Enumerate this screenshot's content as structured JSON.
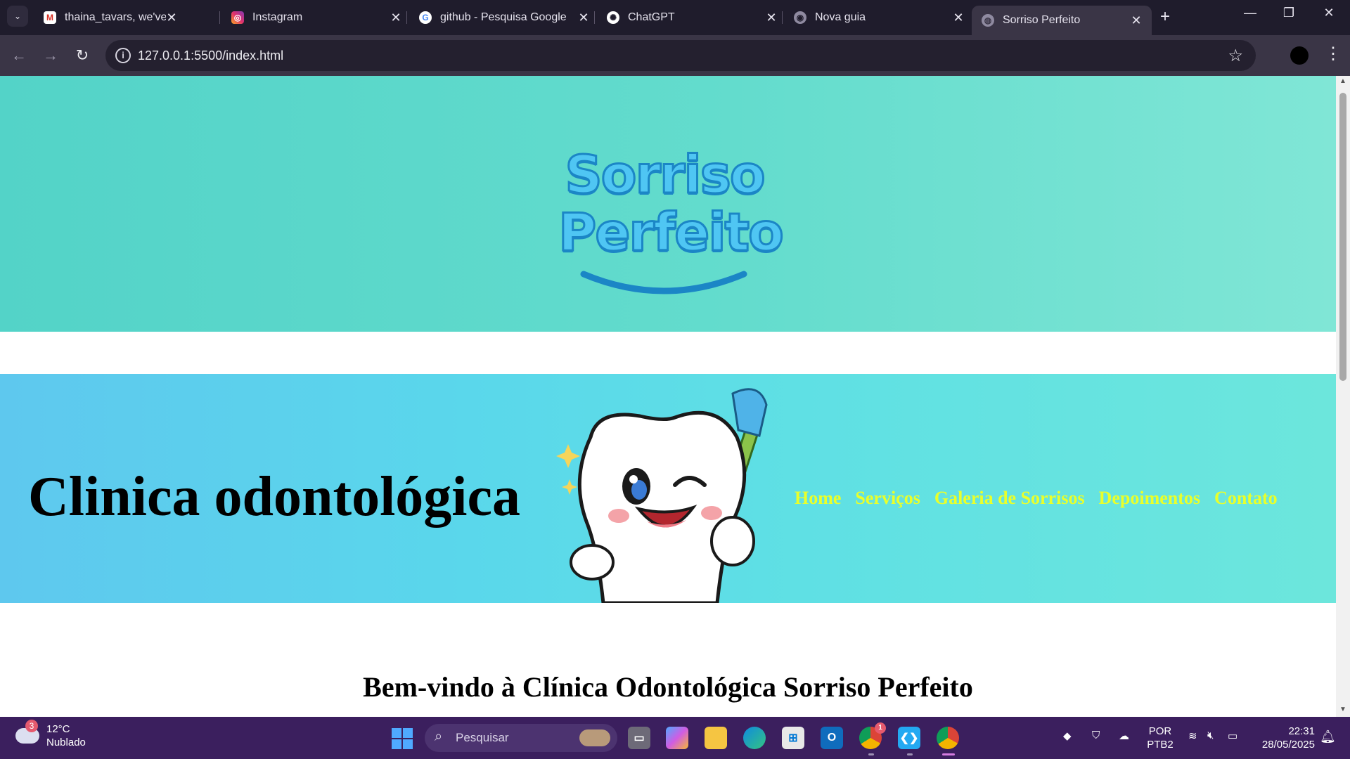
{
  "browser": {
    "tabs": [
      {
        "title": "thaina_tavars, we've made",
        "favicon": "gmail-icon",
        "active": false
      },
      {
        "title": "Instagram",
        "favicon": "instagram-icon",
        "active": false
      },
      {
        "title": "github - Pesquisa Google",
        "favicon": "google-icon",
        "active": false
      },
      {
        "title": "ChatGPT",
        "favicon": "chatgpt-icon",
        "active": false
      },
      {
        "title": "Nova guia",
        "favicon": "chrome-icon",
        "active": false
      },
      {
        "title": "Sorriso Perfeito",
        "favicon": "globe-icon",
        "active": true
      }
    ],
    "url": "127.0.0.1:5500/index.html"
  },
  "page": {
    "logo": {
      "line1": "Sorriso",
      "line2": "Perfeito"
    },
    "banner_title": "Clinica odontológica",
    "nav": [
      "Home",
      "Serviços",
      "Galeria de Sorrisos",
      "Depoimentos",
      "Contato"
    ],
    "welcome_heading": "Bem-vindo à Clínica Odontológica Sorriso Perfeito",
    "colors": {
      "header_bg": "#5ed8cb",
      "banner_bg": "#5fd6ea",
      "nav_link": "#e9ff2a",
      "logo_text": "#4fc6f3"
    }
  },
  "taskbar": {
    "weather": {
      "temp": "12°C",
      "condition": "Nublado",
      "badge": "3"
    },
    "search_placeholder": "Pesquisar",
    "chrome_badge": "1",
    "language": {
      "line1": "POR",
      "line2": "PTB2"
    },
    "clock": {
      "time": "22:31",
      "date": "28/05/2025"
    }
  }
}
